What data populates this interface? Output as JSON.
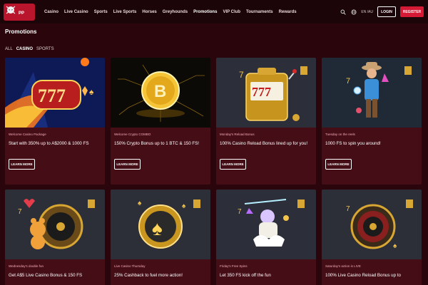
{
  "brand": {
    "logo_text": "PIRATEPOTS",
    "accent": "#d41a34",
    "background": "#2a060c",
    "card_background": "#450e17"
  },
  "nav": {
    "items": [
      {
        "label": "Casino"
      },
      {
        "label": "Live Casino"
      },
      {
        "label": "Sports"
      },
      {
        "label": "Live Sports"
      },
      {
        "label": "Horses"
      },
      {
        "label": "Greyhounds"
      },
      {
        "label": "Promotions",
        "active": true
      },
      {
        "label": "VIP Club"
      },
      {
        "label": "Tournaments"
      },
      {
        "label": "Rewards"
      }
    ]
  },
  "header": {
    "icons": [
      "search-icon",
      "globe-icon"
    ],
    "lang_label": "EN /AU",
    "login_label": "LOGIN",
    "register_label": "REGISTER"
  },
  "page": {
    "title": "Promotions"
  },
  "filters": {
    "items": [
      {
        "label": "ALL"
      },
      {
        "label": "CASINO",
        "active": true
      },
      {
        "label": "SPORTS"
      }
    ]
  },
  "cards": [
    {
      "subtitle": "Welcome Casino Package",
      "title": "Start with 350% up to A$2000 & 1000 FS",
      "button": "LEARN MORE",
      "image": "slot-777-icon"
    },
    {
      "subtitle": "Welcome Crypto COMBO",
      "title": "150% Crypto Bonus up to 1 BTC & 150 FS!",
      "button": "LEARN MORE",
      "image": "bitcoin-coin-icon"
    },
    {
      "subtitle": "Monday's Reload Bonus",
      "title": "100% Casino Reload Bonus lined up for you!",
      "button": "LEARN MORE",
      "image": "slot-machine-icon"
    },
    {
      "subtitle": "Tuesday on the reels",
      "title": "1000 FS to spin you around!",
      "button": "LEARN MORE",
      "image": "cowboy-character-icon"
    },
    {
      "subtitle": "Wednesday's double fun",
      "title": "Get A$5 Live Casino Bonus & 150 FS",
      "image": "roulette-bear-icon"
    },
    {
      "subtitle": "Live Casino Thursday",
      "title": "25% Cashback to fuel more action!",
      "image": "spade-chip-icon"
    },
    {
      "subtitle": "Friday's Free Spins",
      "title": "Let 350 FS kick off the fun",
      "image": "unicorn-rider-icon"
    },
    {
      "subtitle": "Saturday's action is LIVE",
      "title": "100% Live Casino Reload Bonus up to",
      "image": "roulette-wheel-icon"
    }
  ]
}
